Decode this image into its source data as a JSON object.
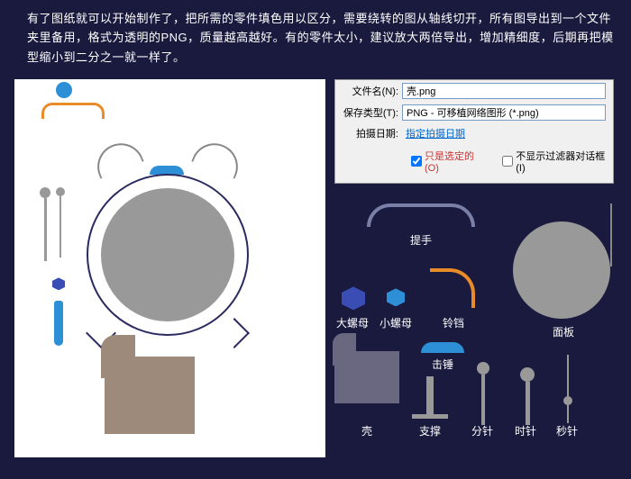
{
  "instruction": "有了图纸就可以开始制作了，把所需的零件填色用以区分，需要绕转的图从轴线切开，所有图导出到一个文件夹里备用，格式为透明的PNG，质量越高越好。有的零件太小，建议放大两倍导出，增加精细度，后期再把模型缩小到二分之一就一样了。",
  "dialog": {
    "filename_label": "文件名(N):",
    "filename_value": "壳.png",
    "savetype_label": "保存类型(T):",
    "savetype_value": "PNG - 可移植网络图形 (*.png)",
    "shootdate_label": "拍摄日期:",
    "shootdate_link": "指定拍摄日期",
    "cb1_label": "只是选定的(O)",
    "cb2_label": "不显示过滤器对话框(I)"
  },
  "parts": {
    "handle": "提手",
    "nut_big": "大螺母",
    "nut_small": "小螺母",
    "bell": "铃铛",
    "panel": "面板",
    "hammer": "击锤",
    "case": "壳",
    "stand": "支撑",
    "minute": "分针",
    "hour": "时针",
    "second": "秒针"
  }
}
